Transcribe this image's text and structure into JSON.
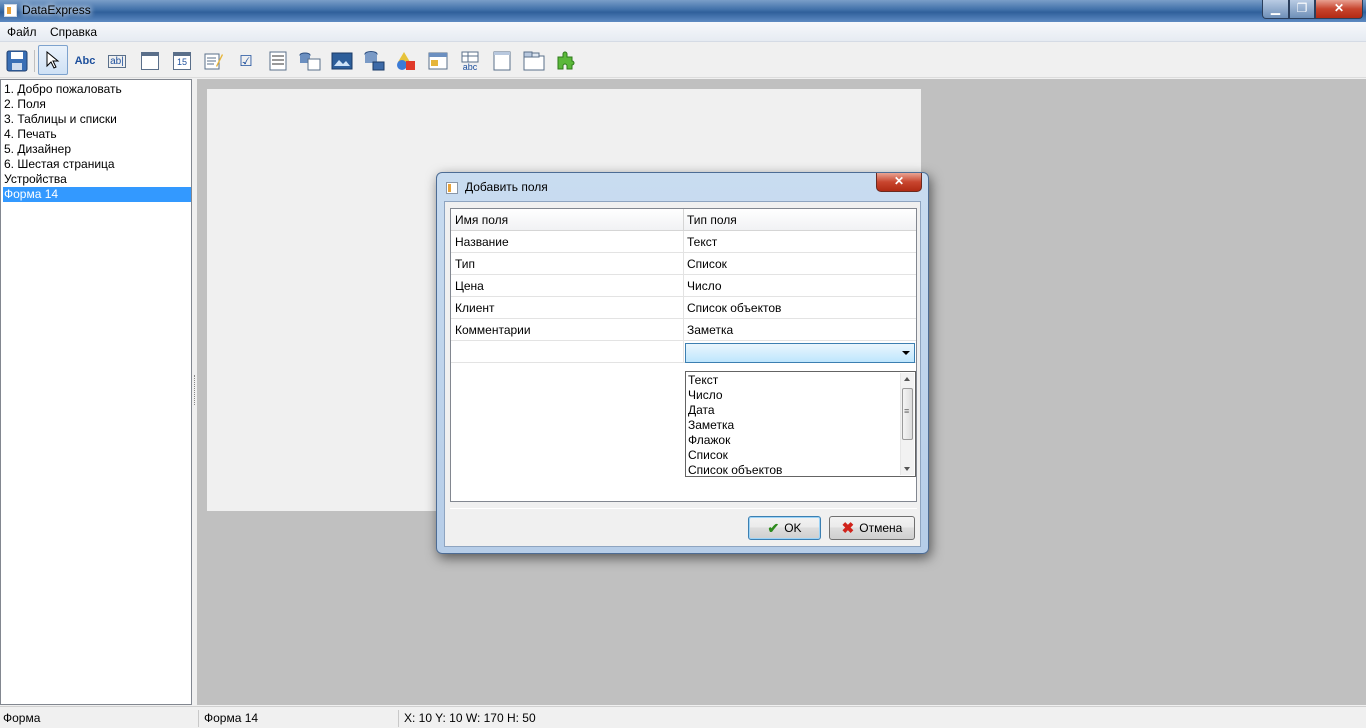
{
  "window": {
    "title": "DataExpress",
    "minimize": "▁",
    "maximize": "❐",
    "close": "✕"
  },
  "menu": [
    {
      "label": "Файл"
    },
    {
      "label": "Справка"
    }
  ],
  "toolbar": {
    "label_tool": "Abc",
    "textbox_tool": "ab|",
    "number_tool": "15",
    "checkbox_tool": "☑",
    "grid_tool": "abc"
  },
  "sidebar": {
    "items": [
      {
        "label": "1. Добро пожаловать"
      },
      {
        "label": "2. Поля"
      },
      {
        "label": "3. Таблицы и списки"
      },
      {
        "label": "4. Печать"
      },
      {
        "label": "5. Дизайнер"
      },
      {
        "label": "6. Шестая страница"
      },
      {
        "label": "Устройства"
      },
      {
        "label": "Форма 14"
      }
    ],
    "selected_index": 7
  },
  "dialog": {
    "title": "Добавить поля",
    "close": "✕",
    "columns": {
      "name": "Имя поля",
      "type": "Тип поля"
    },
    "rows": [
      {
        "name": "Название",
        "type": "Текст"
      },
      {
        "name": "Тип",
        "type": "Список"
      },
      {
        "name": "Цена",
        "type": "Число"
      },
      {
        "name": "Клиент",
        "type": "Список объектов"
      },
      {
        "name": "Комментарии",
        "type": "Заметка"
      }
    ],
    "dropdown_options": [
      "Текст",
      "Число",
      "Дата",
      "Заметка",
      "Флажок",
      "Список",
      "Список объектов"
    ],
    "ok_label": "OK",
    "ok_icon": "✔",
    "cancel_label": "Отмена",
    "cancel_icon": "✖"
  },
  "status": {
    "left": "Форма",
    "middle": "Форма 14",
    "right": "X: 10 Y: 10 W: 170 H: 50"
  },
  "colors": {
    "selection": "#3399ff",
    "workarea": "#c0c0c0",
    "titlebar": "#3f6fa8",
    "combo_highlight": "#bee6fd"
  }
}
